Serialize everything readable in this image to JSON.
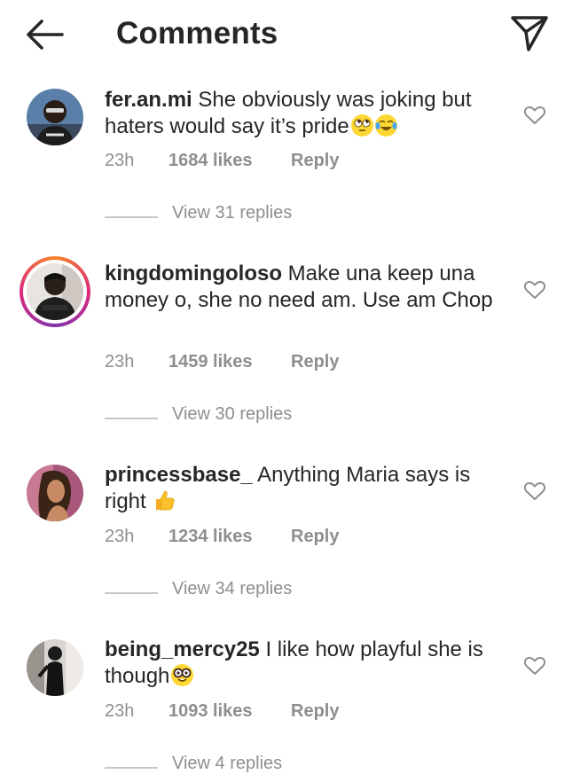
{
  "header": {
    "title": "Comments",
    "back_icon": "arrow-left-icon",
    "share_icon": "paper-plane-icon"
  },
  "comments": [
    {
      "username": "fer.an.mi",
      "text": "She obviously was joking but haters would say it’s pride",
      "emojis": [
        "face-with-rolling-eyes",
        "face-with-tears-of-joy"
      ],
      "time": "23h",
      "likes": "1684 likes",
      "reply": "Reply",
      "replies": "View 31 replies",
      "story_ring": false
    },
    {
      "username": "kingdomingoloso",
      "text": "Make una keep una money o, she no need am. Use am Chop",
      "emojis": [],
      "time": "23h",
      "likes": "1459 likes",
      "reply": "Reply",
      "replies": "View 30 replies",
      "story_ring": true
    },
    {
      "username": "princessbase_",
      "text": "Anything Maria says is right",
      "emojis": [
        "thumbs-up"
      ],
      "time": "23h",
      "likes": "1234 likes",
      "reply": "Reply",
      "replies": "View 34 replies",
      "story_ring": false
    },
    {
      "username": "being_mercy25",
      "text": "I like how playful she is though",
      "emojis": [
        "nerd-face"
      ],
      "time": "23h",
      "likes": "1093 likes",
      "reply": "Reply",
      "replies": "View 4 replies",
      "story_ring": false
    }
  ],
  "colors": {
    "text": "#262626",
    "muted": "#8e8e8e",
    "divider": "#c7c7c7",
    "story_ring": [
      "#f58529",
      "#dd2a7b",
      "#8134af"
    ]
  }
}
